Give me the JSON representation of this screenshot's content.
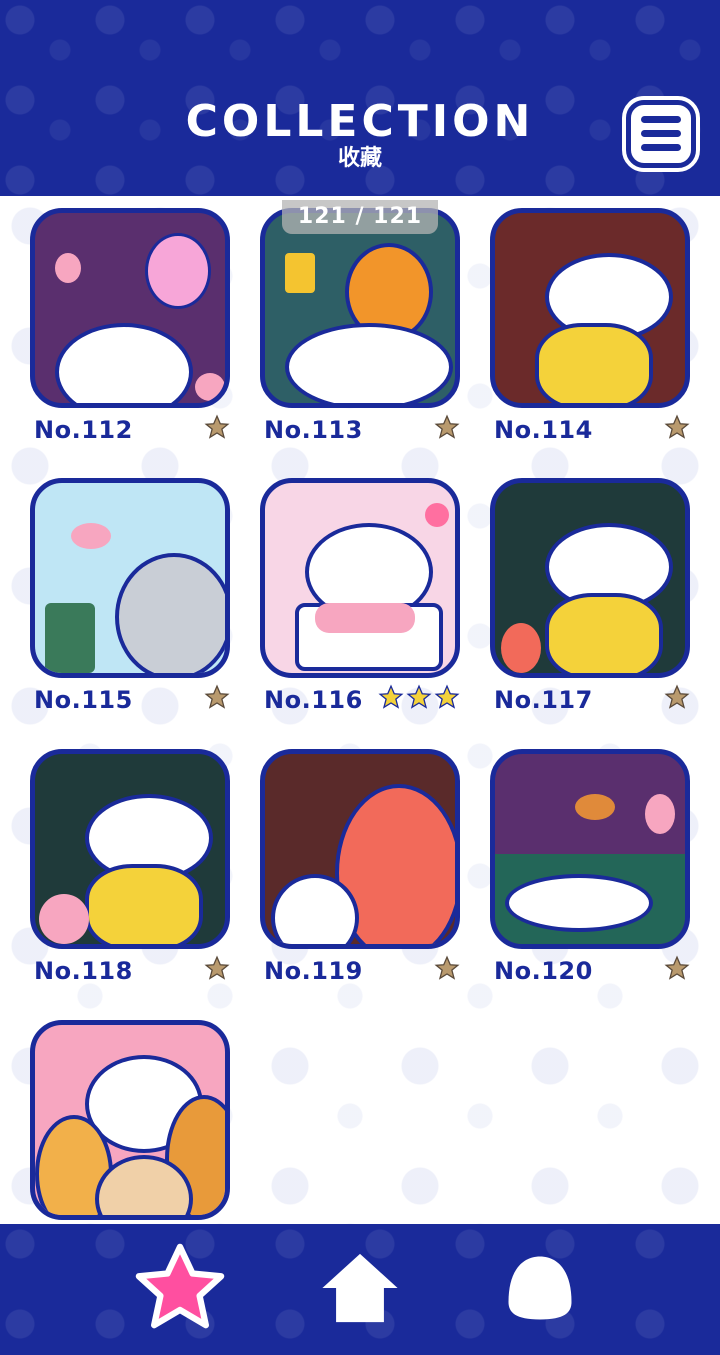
{
  "header": {
    "title": "COLLECTION",
    "subtitle": "收藏",
    "menu_icon": "menu-icon"
  },
  "counter": "121 / 121",
  "colors": {
    "primary": "#1a2a9a",
    "star_gold": "#f4d23a",
    "star_brown": "#b99a6e",
    "nav_star": "#ff4fa0"
  },
  "cards": [
    {
      "label": "No.112",
      "stars": 1,
      "bg": "#5a2f6e"
    },
    {
      "label": "No.113",
      "stars": 1,
      "bg": "#2e5f66"
    },
    {
      "label": "No.114",
      "stars": 1,
      "bg": "#6b2a2a"
    },
    {
      "label": "No.115",
      "stars": 1,
      "bg": "#bfe6f5"
    },
    {
      "label": "No.116",
      "stars": 3,
      "bg": "#f8d6e6"
    },
    {
      "label": "No.117",
      "stars": 1,
      "bg": "#1f3a3a"
    },
    {
      "label": "No.118",
      "stars": 1,
      "bg": "#1f3a3a"
    },
    {
      "label": "No.119",
      "stars": 1,
      "bg": "#5a2a2a"
    },
    {
      "label": "No.120",
      "stars": 1,
      "bg": "#5a2f6e"
    },
    {
      "label": "",
      "stars": 0,
      "bg": "#f7a6c0"
    }
  ],
  "nav": {
    "items": [
      "star-icon",
      "home-icon",
      "blob-icon"
    ]
  }
}
